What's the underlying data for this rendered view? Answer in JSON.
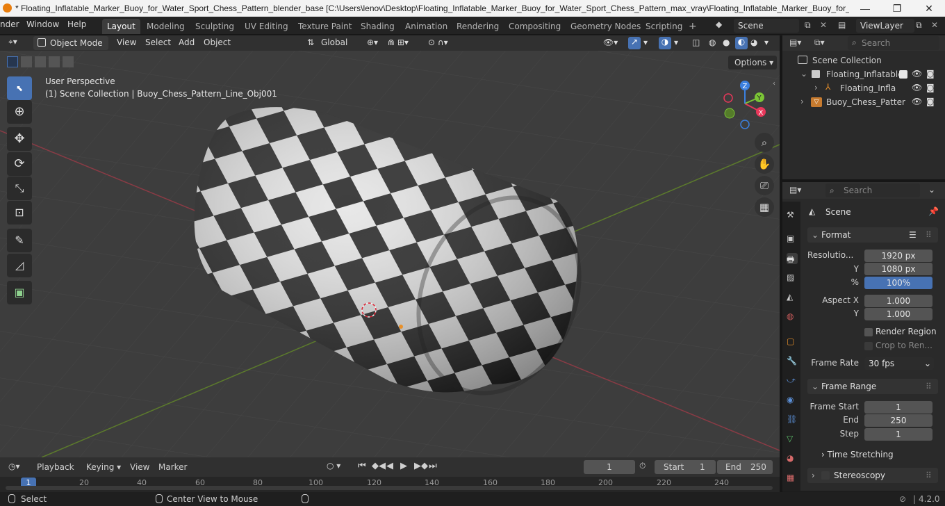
{
  "window": {
    "title": "* Floating_Inflatable_Marker_Buoy_for_Water_Sport_Chess_Pattern_blender_base [C:\\Users\\lenov\\Desktop\\Floating_Inflatable_Marker_Buoy_for_Water_Sport_Chess_Pattern_max_vray\\Floating_Inflatable_Marker_Buoy_for_Water...",
    "minimize": "—",
    "maximize": "❐",
    "close": "✕"
  },
  "menu": {
    "render": "nder",
    "window": "Window",
    "help": "Help"
  },
  "workspaces": [
    "Layout",
    "Modeling",
    "Sculpting",
    "UV Editing",
    "Texture Paint",
    "Shading",
    "Animation",
    "Rendering",
    "Compositing",
    "Geometry Nodes",
    "Scripting"
  ],
  "add_workspace": "+",
  "scene_name": "Scene",
  "view_layer": "ViewLayer",
  "viewport_header": {
    "mode": "Object Mode",
    "view": "View",
    "select": "Select",
    "add": "Add",
    "object": "Object",
    "transform": "Global",
    "options": "Options"
  },
  "viewport": {
    "perspective": "User Perspective",
    "collection_info": "(1) Scene Collection | Buoy_Chess_Pattern_Line_Obj001",
    "gizmo": {
      "x": "X",
      "y": "Y",
      "z": "Z"
    }
  },
  "outliner": {
    "search_placeholder": "Search",
    "items": [
      {
        "label": "Scene Collection"
      },
      {
        "label": "Floating_Inflatable"
      },
      {
        "label": "Floating_Inflata"
      },
      {
        "label": "Buoy_Chess_Patter"
      }
    ]
  },
  "properties": {
    "search_placeholder": "Search",
    "context": "Scene",
    "format": {
      "title": "Format",
      "resolution_x_label": "Resolutio...",
      "resolution_x": "1920 px",
      "resolution_y_label": "Y",
      "resolution_y": "1080 px",
      "percent_label": "%",
      "percent": "100%",
      "aspect_x_label": "Aspect X",
      "aspect_x": "1.000",
      "aspect_y_label": "Y",
      "aspect_y": "1.000",
      "render_region": "Render Region",
      "crop": "Crop to Ren...",
      "frame_rate_label": "Frame Rate",
      "frame_rate": "30 fps"
    },
    "frame_range": {
      "title": "Frame Range",
      "start_label": "Frame Start",
      "start": "1",
      "end_label": "End",
      "end": "250",
      "step_label": "Step",
      "step": "1"
    },
    "time_stretching": "Time Stretching",
    "stereoscopy": "Stereoscopy"
  },
  "timeline": {
    "playback": "Playback",
    "keying": "Keying",
    "view": "View",
    "marker": "Marker",
    "current_frame": "1",
    "start_label": "Start",
    "start": "1",
    "end_label": "End",
    "end": "250",
    "ticks": [
      "1",
      "20",
      "40",
      "60",
      "80",
      "100",
      "120",
      "140",
      "160",
      "180",
      "200",
      "220",
      "240"
    ]
  },
  "status": {
    "select": "Select",
    "center": "Center View to Mouse",
    "version": "4.2.0"
  },
  "colors": {
    "accent": "#4772b3",
    "x_axis": "#e8375a",
    "y_axis": "#7bc536",
    "z_axis": "#3b80e0"
  }
}
